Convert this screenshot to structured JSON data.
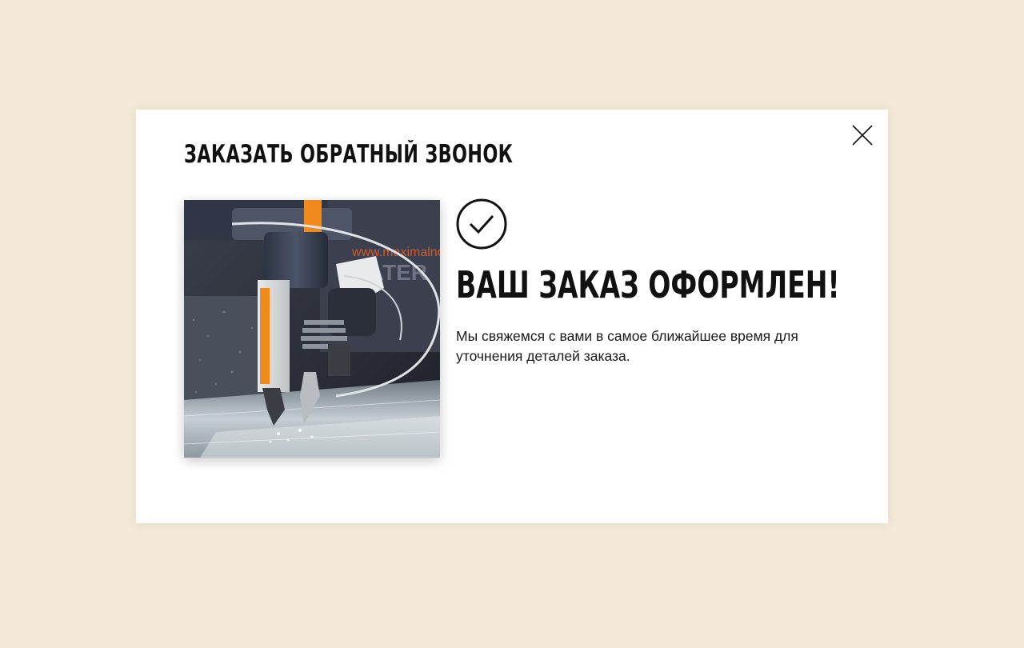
{
  "modal": {
    "title": "ЗАКАЗАТЬ ОБРАТНЫЙ ЗВОНОК",
    "close_icon": "close-icon",
    "image": {
      "description_icon": "waterjet-cutting-machine-photo",
      "watermark_text": "www.maximalnoe",
      "watermark_word": "WATER"
    },
    "success": {
      "icon": "checkmark-circle-icon",
      "title": "ВАШ ЗАКАЗ ОФОРМЛЕН!",
      "message": "Мы свяжемся с вами в самое ближайшее время для уточнения деталей заказа."
    }
  },
  "colors": {
    "page_background": "#f4e9d8",
    "modal_background": "#ffffff",
    "text": "#111111",
    "accent_orange": "#f08a1c"
  }
}
